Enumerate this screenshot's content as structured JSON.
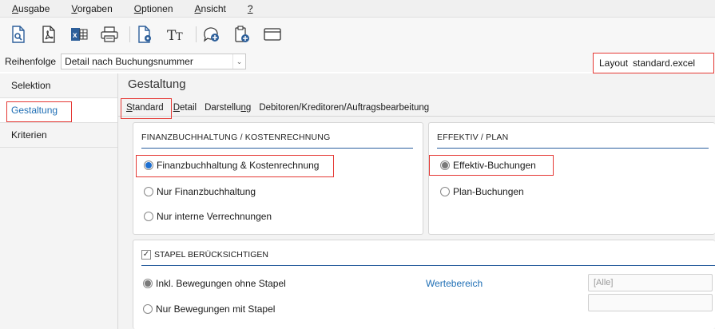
{
  "menu": {
    "items": [
      {
        "pre": "",
        "ul": "A",
        "post": "usgabe"
      },
      {
        "pre": "",
        "ul": "V",
        "post": "orgaben"
      },
      {
        "pre": "",
        "ul": "O",
        "post": "ptionen"
      },
      {
        "pre": "",
        "ul": "A",
        "post": "nsicht"
      },
      {
        "pre": "",
        "ul": "?",
        "post": ""
      }
    ]
  },
  "toolbar": {
    "icons": [
      "preview-icon",
      "pdf-icon",
      "excel-icon",
      "print-icon",
      "page-settings-icon",
      "font-icon",
      "comment-add-icon",
      "clipboard-add-icon",
      "window-icon"
    ]
  },
  "sort": {
    "label": "Reihenfolge",
    "value": "Detail nach Buchungsnummer"
  },
  "layout": {
    "label": "Layout",
    "value": "standard.excel"
  },
  "sidebar": {
    "items": [
      {
        "label": "Selektion"
      },
      {
        "label": "Gestaltung"
      },
      {
        "label": "Kriterien"
      }
    ]
  },
  "main": {
    "title": "Gestaltung"
  },
  "tabs": [
    {
      "pre": "",
      "ul": "S",
      "post": "tandard"
    },
    {
      "pre": "",
      "ul": "D",
      "post": "etail"
    },
    {
      "pre": "Darstellu",
      "ul": "n",
      "post": "g"
    },
    {
      "pre": "Debitoren/Kreditoren/Auftragsbearbeitung",
      "ul": "",
      "post": ""
    }
  ],
  "panel_fibu": {
    "title": "FINANZBUCHHALTUNG / KOSTENRECHNUNG",
    "options": [
      {
        "label": "Finanzbuchhaltung & Kostenrechnung"
      },
      {
        "label": "Nur Finanzbuchhaltung"
      },
      {
        "label": "Nur interne Verrechnungen"
      }
    ]
  },
  "panel_effektiv": {
    "title": "EFFEKTIV / PLAN",
    "options": [
      {
        "label": "Effektiv-Buchungen"
      },
      {
        "label": "Plan-Buchungen"
      }
    ]
  },
  "panel_stapel": {
    "checkbox_label": "STAPEL BERÜCKSICHTIGEN",
    "checkbox_mark": "✓",
    "options": [
      {
        "label": "Inkl. Bewegungen ohne Stapel"
      },
      {
        "label": "Nur Bewegungen mit Stapel"
      }
    ],
    "range_label": "Wertebereich",
    "range_value": "[Alle]"
  },
  "colors": {
    "accent": "#1f6fb5",
    "highlight": "#e53935",
    "radio_selected": "#1e6fd0"
  }
}
